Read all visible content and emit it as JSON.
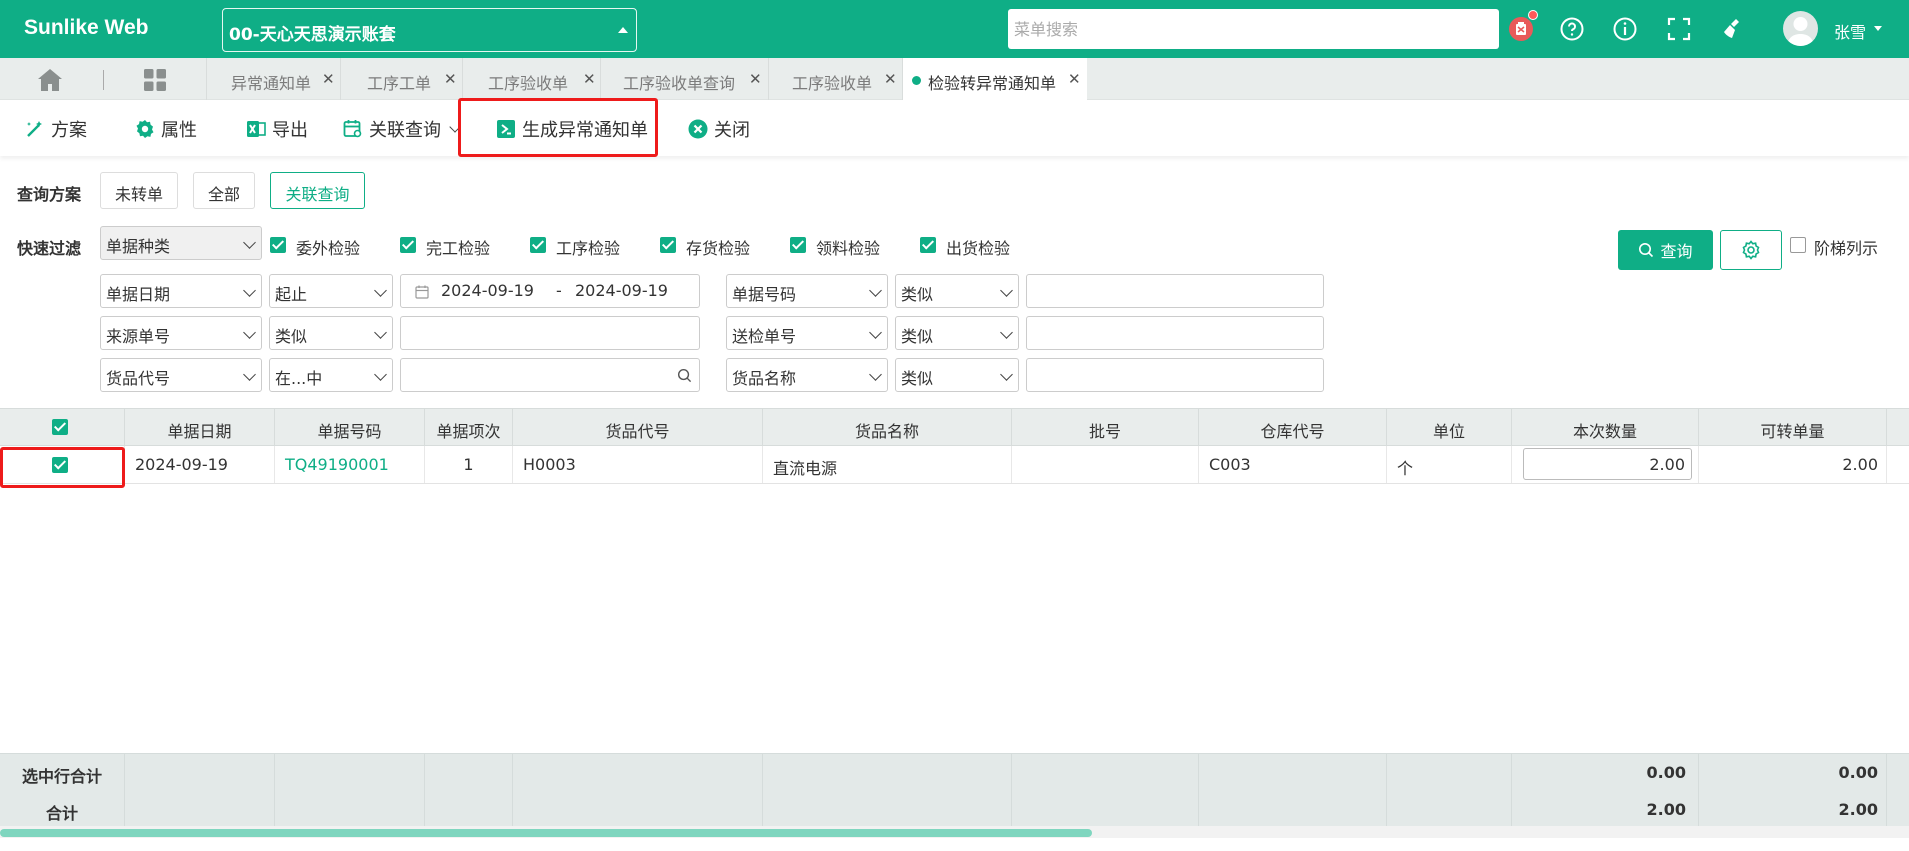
{
  "app": {
    "brand": "Sunlike Web",
    "account": "00-天心天思演示账套",
    "menu_search_placeholder": "菜单搜索",
    "user_name": "张雪"
  },
  "tabs": [
    {
      "label": "异常通知单",
      "active": false
    },
    {
      "label": "工序工单",
      "active": false
    },
    {
      "label": "工序验收单",
      "active": false
    },
    {
      "label": "工序验收单查询",
      "active": false
    },
    {
      "label": "工序验收单",
      "active": false
    },
    {
      "label": "检验转异常通知单",
      "active": true
    }
  ],
  "toolbar": {
    "scheme": "方案",
    "properties": "属性",
    "export": "导出",
    "related_query": "关联查询",
    "generate": "生成异常通知单",
    "close": "关闭"
  },
  "query_scheme": {
    "label": "查询方案",
    "options": [
      "未转单",
      "全部",
      "关联查询"
    ],
    "active_index": 2
  },
  "quick_filter": {
    "label": "快速过滤",
    "doc_type_select": "单据种类",
    "checkboxes": [
      "委外检验",
      "完工检验",
      "工序检验",
      "存货检验",
      "领料检验",
      "出货检验"
    ],
    "search_button": "查询",
    "ladder_label": "阶梯列示",
    "rows": [
      {
        "field": "单据日期",
        "op": "起止",
        "date_from": "2024-09-19",
        "date_sep": "-",
        "date_to": "2024-09-19",
        "field2": "单据号码",
        "op2": "类似",
        "value2": ""
      },
      {
        "field": "来源单号",
        "op": "类似",
        "value": "",
        "field2": "送检单号",
        "op2": "类似",
        "value2": ""
      },
      {
        "field": "货品代号",
        "op": "在...中",
        "value": "",
        "field2": "货品名称",
        "op2": "类似",
        "value2": ""
      }
    ]
  },
  "grid": {
    "columns": [
      "单据日期",
      "单据号码",
      "单据项次",
      "货品代号",
      "货品名称",
      "批号",
      "仓库代号",
      "单位",
      "本次数量",
      "可转单量"
    ],
    "rows": [
      {
        "date": "2024-09-19",
        "doc_no": "TQ49190001",
        "item": "1",
        "code": "H0003",
        "name": "直流电源",
        "batch": "",
        "warehouse": "C003",
        "unit": "个",
        "qty": "2.00",
        "avail": "2.00"
      }
    ],
    "footer": [
      {
        "label": "选中行合计",
        "qty": "0.00",
        "avail": "0.00"
      },
      {
        "label": "合计",
        "qty": "2.00",
        "avail": "2.00"
      }
    ]
  },
  "colors": {
    "accent": "#0fae86",
    "highlight": "#ee1b1b"
  },
  "icons": [
    "home-icon",
    "grid-icon",
    "notice-icon",
    "help-icon",
    "info-icon",
    "fullscreen-icon",
    "clean-icon",
    "avatar-icon",
    "wand-icon",
    "gear-icon",
    "excel-icon",
    "calendar-query-icon",
    "generate-icon",
    "close-circle-icon",
    "search-icon",
    "calendar-icon"
  ]
}
